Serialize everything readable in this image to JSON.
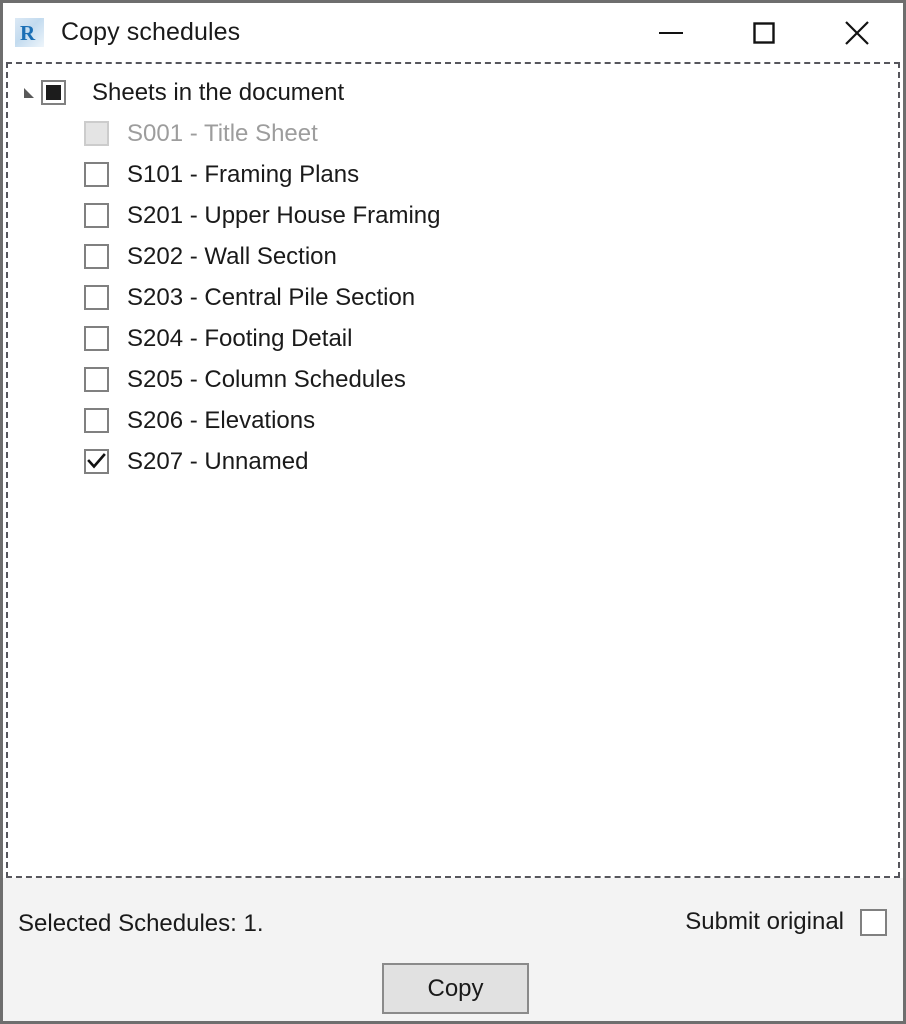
{
  "window": {
    "title": "Copy schedules",
    "app_icon": "revit-r-icon",
    "controls": [
      {
        "name": "minimize",
        "icon": "minimize-icon"
      },
      {
        "name": "maximize",
        "icon": "maximize-icon"
      },
      {
        "name": "close",
        "icon": "close-icon"
      }
    ]
  },
  "tree": {
    "root": {
      "label": "Sheets in the document",
      "checkbox_state": "indeterminate",
      "expanded": true,
      "expander_icon": "triangle-expanded-icon"
    },
    "items": [
      {
        "label": "S001 - Title Sheet",
        "checked": false,
        "disabled": true
      },
      {
        "label": "S101 - Framing Plans",
        "checked": false,
        "disabled": false
      },
      {
        "label": "S201 - Upper House Framing",
        "checked": false,
        "disabled": false
      },
      {
        "label": "S202 - Wall Section",
        "checked": false,
        "disabled": false
      },
      {
        "label": "S203 - Central Pile Section",
        "checked": false,
        "disabled": false
      },
      {
        "label": "S204 - Footing Detail",
        "checked": false,
        "disabled": false
      },
      {
        "label": "S205 - Column Schedules",
        "checked": false,
        "disabled": false
      },
      {
        "label": "S206 - Elevations",
        "checked": false,
        "disabled": false
      },
      {
        "label": "S207 - Unnamed",
        "checked": true,
        "disabled": false
      }
    ]
  },
  "footer": {
    "status": "Selected Schedules: 1.",
    "submit_original_label": "Submit original",
    "submit_original_checked": false,
    "copy_button": "Copy"
  },
  "colors": {
    "window_border": "#6e6e6e",
    "panel_background": "#ffffff",
    "footer_background": "#f3f3f3",
    "text": "#1a1a1a",
    "disabled_text": "#9d9d9d",
    "checkbox_border": "#808080",
    "button_face": "#e1e1e1",
    "accent_icon_blue": "#1a6fbd"
  }
}
